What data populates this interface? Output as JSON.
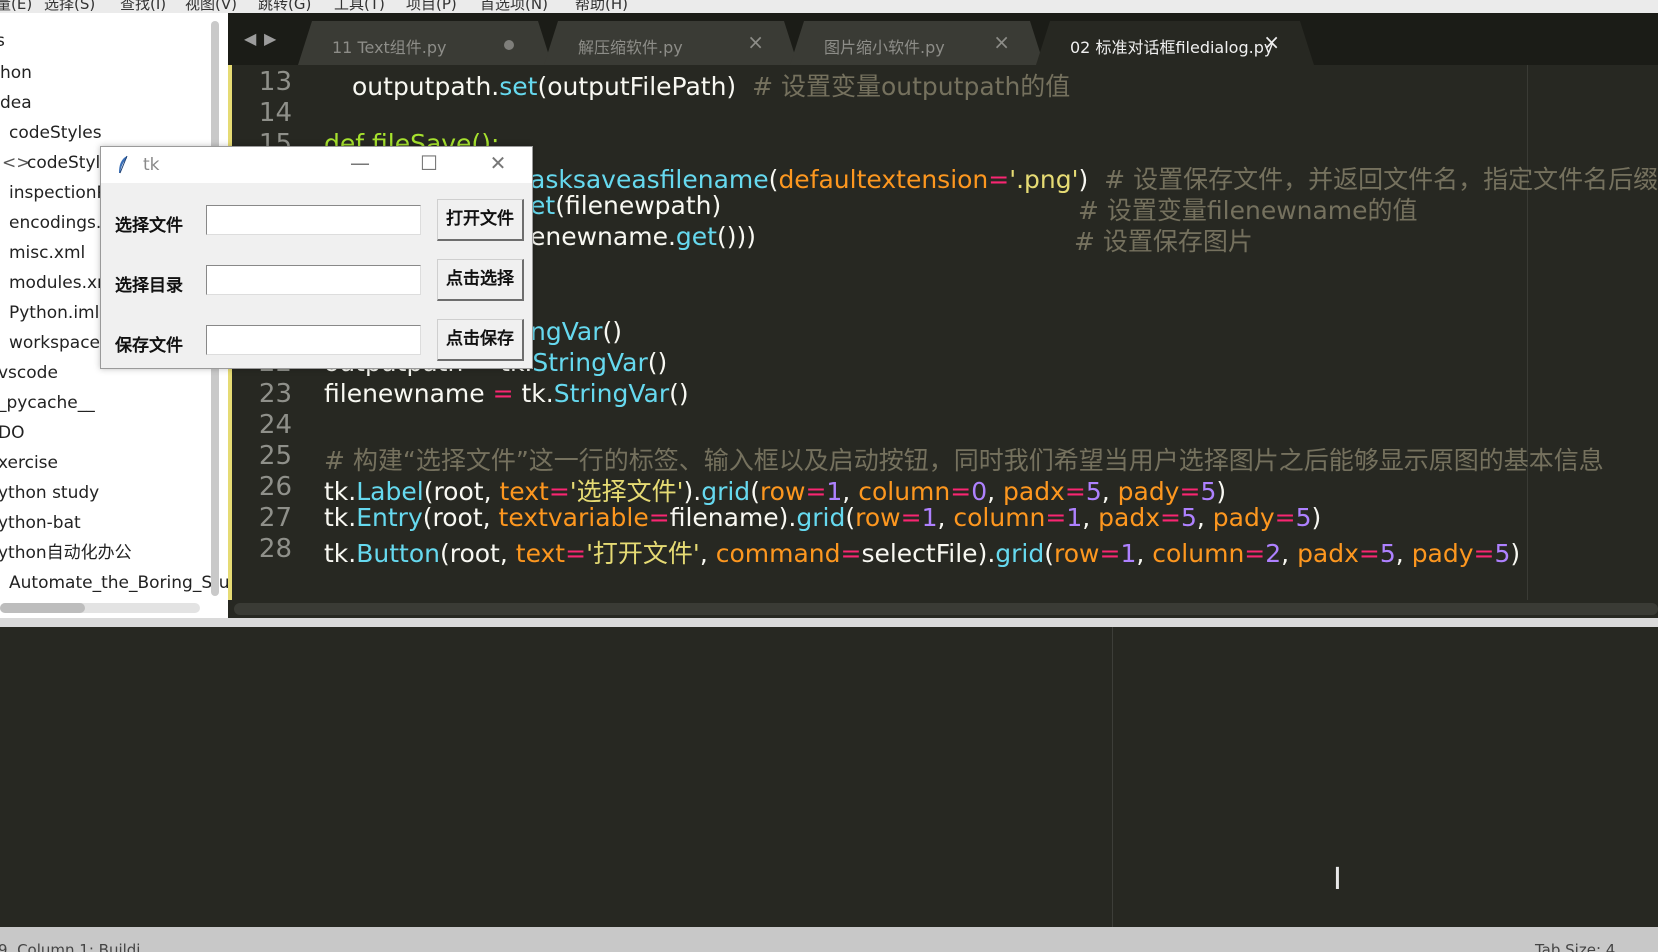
{
  "menubar": {
    "items": [
      "量(E)",
      "选择(S)",
      "查找(I)",
      "视图(V)",
      "跳转(G)",
      "工具(T)",
      "项目(P)",
      "首选项(N)",
      "帮助(H)"
    ]
  },
  "sidebar": {
    "items": [
      "s",
      "hon",
      "dea",
      "codeStyles",
      "codeStyle",
      "inspectionP",
      "encodings.x",
      "misc.xml",
      "modules.xm",
      "Python.iml",
      "workspace.x",
      "vscode",
      "_pycache__",
      "DO",
      "xercise",
      "ython study",
      "ython-bat",
      "ython自动化办公",
      "Automate_the_Boring_Stu"
    ]
  },
  "tabs": [
    {
      "label": "11 Text组件.py",
      "state": "modified"
    },
    {
      "label": "解压缩软件.py",
      "state": "close"
    },
    {
      "label": "图片缩小软件.py",
      "state": "close"
    },
    {
      "label": "02 标准对话框filedialog.py",
      "state": "active"
    }
  ],
  "editor": {
    "line_numbers": [
      "13",
      "14",
      "15",
      "",
      "",
      "",
      "",
      "",
      "22",
      "23",
      "24",
      "25",
      "26",
      "27",
      "28"
    ],
    "lines": {
      "l13a": "outputpath.",
      "l13b": "set",
      "l13c": "(outputFilePath)  ",
      "l13d": "# 设置变量outputpath的值",
      "l15": "def fileSave():",
      "l16a": "asksaveasfilename",
      "l16b": "(",
      "l16c": "defaultextension",
      "l16d": "=",
      "l16e": "'.png'",
      "l16f": ")  ",
      "l16g": "# 设置保存文件，并返回文件名，指定文件名后缀为",
      "l17a": "et",
      "l17b": "(filenewpath)",
      "l17c": "# 设置变量filenewname的值",
      "l18a": "enewname.",
      "l18b": "get",
      "l18c": "()))",
      "l18d": "# 设置保存图片",
      "l21a": "ngVar",
      "l21b": "()",
      "l22a": "outputpath ",
      "l22b": "=",
      "l22c": " tk.",
      "l22d": "StringVar",
      "l22e": "()",
      "l23a": "filenewname ",
      "l23b": "=",
      "l23c": " tk.",
      "l23d": "StringVar",
      "l23e": "()",
      "l25": "# 构建“选择文件”这一行的标签、输入框以及启动按钮，同时我们希望当用户选择图片之后能够显示原图的基本信息",
      "l26": [
        [
          "c-w",
          "tk."
        ],
        [
          "c-fn",
          "Label"
        ],
        [
          "c-w",
          "(root, "
        ],
        [
          "c-arg",
          "text"
        ],
        [
          "c-op",
          "="
        ],
        [
          "c-str",
          "'选择文件'"
        ],
        [
          "c-w",
          ")."
        ],
        [
          "c-fn",
          "grid"
        ],
        [
          "c-w",
          "("
        ],
        [
          "c-arg",
          "row"
        ],
        [
          "c-op",
          "="
        ],
        [
          "c-num",
          "1"
        ],
        [
          "c-w",
          ", "
        ],
        [
          "c-arg",
          "column"
        ],
        [
          "c-op",
          "="
        ],
        [
          "c-num",
          "0"
        ],
        [
          "c-w",
          ", "
        ],
        [
          "c-arg",
          "padx"
        ],
        [
          "c-op",
          "="
        ],
        [
          "c-num",
          "5"
        ],
        [
          "c-w",
          ", "
        ],
        [
          "c-arg",
          "pady"
        ],
        [
          "c-op",
          "="
        ],
        [
          "c-num",
          "5"
        ],
        [
          "c-w",
          ")"
        ]
      ],
      "l27": [
        [
          "c-w",
          "tk."
        ],
        [
          "c-fn",
          "Entry"
        ],
        [
          "c-w",
          "(root, "
        ],
        [
          "c-arg",
          "textvariable"
        ],
        [
          "c-op",
          "="
        ],
        [
          "c-w",
          "filename)."
        ],
        [
          "c-fn",
          "grid"
        ],
        [
          "c-w",
          "("
        ],
        [
          "c-arg",
          "row"
        ],
        [
          "c-op",
          "="
        ],
        [
          "c-num",
          "1"
        ],
        [
          "c-w",
          ", "
        ],
        [
          "c-arg",
          "column"
        ],
        [
          "c-op",
          "="
        ],
        [
          "c-num",
          "1"
        ],
        [
          "c-w",
          ", "
        ],
        [
          "c-arg",
          "padx"
        ],
        [
          "c-op",
          "="
        ],
        [
          "c-num",
          "5"
        ],
        [
          "c-w",
          ", "
        ],
        [
          "c-arg",
          "pady"
        ],
        [
          "c-op",
          "="
        ],
        [
          "c-num",
          "5"
        ],
        [
          "c-w",
          ")"
        ]
      ],
      "l28": [
        [
          "c-w",
          "tk."
        ],
        [
          "c-fn",
          "Button"
        ],
        [
          "c-w",
          "(root, "
        ],
        [
          "c-arg",
          "text"
        ],
        [
          "c-op",
          "="
        ],
        [
          "c-str",
          "'打开文件'"
        ],
        [
          "c-w",
          ", "
        ],
        [
          "c-arg",
          "command"
        ],
        [
          "c-op",
          "="
        ],
        [
          "c-w",
          "selectFile)."
        ],
        [
          "c-fn",
          "grid"
        ],
        [
          "c-w",
          "("
        ],
        [
          "c-arg",
          "row"
        ],
        [
          "c-op",
          "="
        ],
        [
          "c-num",
          "1"
        ],
        [
          "c-w",
          ", "
        ],
        [
          "c-arg",
          "column"
        ],
        [
          "c-op",
          "="
        ],
        [
          "c-num",
          "2"
        ],
        [
          "c-w",
          ", "
        ],
        [
          "c-arg",
          "padx"
        ],
        [
          "c-op",
          "="
        ],
        [
          "c-num",
          "5"
        ],
        [
          "c-w",
          ", "
        ],
        [
          "c-arg",
          "pady"
        ],
        [
          "c-op",
          "="
        ],
        [
          "c-num",
          "5"
        ],
        [
          "c-w",
          ")"
        ]
      ]
    }
  },
  "tk_dialog": {
    "title": "tk",
    "minimize": "—",
    "maximize": "☐",
    "close": "✕",
    "rows": [
      {
        "label": "选择文件",
        "entry": "",
        "button": "打开文件"
      },
      {
        "label": "选择目录",
        "entry": "",
        "button": "点击选择"
      },
      {
        "label": "保存文件",
        "entry": "",
        "button": "点击保存"
      }
    ]
  },
  "statusbar": {
    "left": "9, Column 1; Buildi",
    "right": "Tab Size: 4"
  },
  "colors": {
    "bg": "#272822",
    "comment": "#75715e",
    "function": "#66d9ef",
    "keyword": "#a6e22e",
    "operator": "#f92672",
    "number": "#ae81ff",
    "string": "#e6db74",
    "argument": "#fd971f"
  },
  "icons": {
    "nav_back": "triangle-left-icon",
    "nav_forward": "triangle-right-icon",
    "tk_app": "feather-icon",
    "text_cursor": "ibeam-cursor-icon"
  }
}
